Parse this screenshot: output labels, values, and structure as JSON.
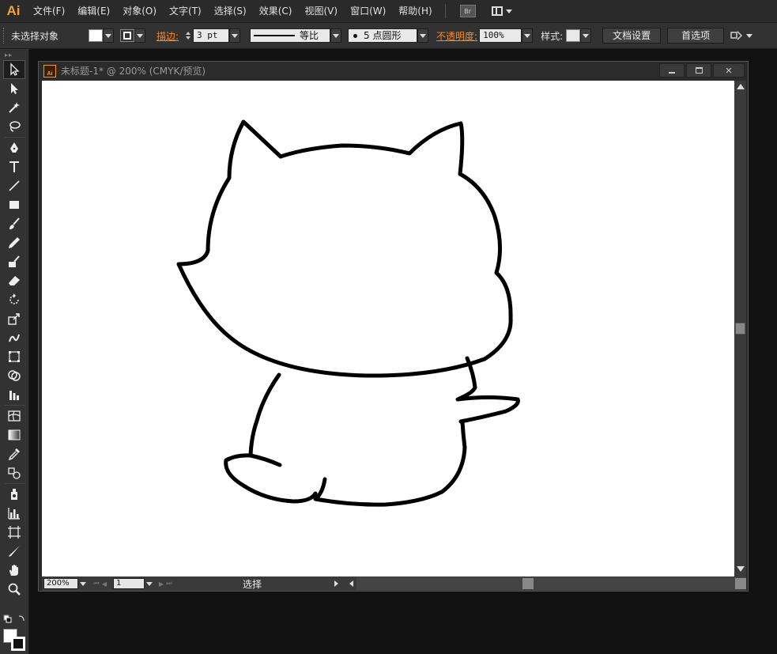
{
  "app": {
    "logo": "Ai",
    "accent": "#f7a32b"
  },
  "menu": [
    {
      "key": "file",
      "label": "文件(F)"
    },
    {
      "key": "edit",
      "label": "编辑(E)"
    },
    {
      "key": "object",
      "label": "对象(O)"
    },
    {
      "key": "type",
      "label": "文字(T)"
    },
    {
      "key": "select",
      "label": "选择(S)"
    },
    {
      "key": "effect",
      "label": "效果(C)"
    },
    {
      "key": "view",
      "label": "视图(V)"
    },
    {
      "key": "window",
      "label": "窗口(W)"
    },
    {
      "key": "help",
      "label": "帮助(H)"
    }
  ],
  "bridge_label": "Br",
  "control": {
    "selection": "未选择对象",
    "stroke_label": "描边:",
    "stroke_weight": "3 pt",
    "stroke_profile": "等比",
    "brush": "5 点圆形",
    "opacity_label": "不透明度:",
    "opacity_value": "100%",
    "style_label": "样式:",
    "doc_setup": "文档设置",
    "prefs": "首选项"
  },
  "document": {
    "title": "未标题-1* @ 200% (CMYK/预览)",
    "icon_label": "Ai",
    "close_symbol": "✕"
  },
  "status": {
    "zoom": "200%",
    "artboard": "1",
    "tool_status": "选择"
  },
  "tools": [
    {
      "name": "selection-tool-icon",
      "active": true
    },
    {
      "name": "direct-selection-tool-icon"
    },
    {
      "name": "magic-wand-tool-icon"
    },
    {
      "name": "lasso-tool-icon"
    },
    {
      "name": "pen-tool-icon"
    },
    {
      "name": "type-tool-icon"
    },
    {
      "name": "line-tool-icon"
    },
    {
      "name": "rectangle-tool-icon"
    },
    {
      "name": "paintbrush-tool-icon"
    },
    {
      "name": "pencil-tool-icon"
    },
    {
      "name": "blob-brush-tool-icon"
    },
    {
      "name": "eraser-tool-icon"
    },
    {
      "name": "rotate-tool-icon"
    },
    {
      "name": "scale-tool-icon"
    },
    {
      "name": "warp-tool-icon"
    },
    {
      "name": "free-transform-tool-icon"
    },
    {
      "name": "shape-builder-tool-icon"
    },
    {
      "name": "graph-tool-icon"
    },
    {
      "name": "mesh-tool-icon"
    },
    {
      "name": "gradient-tool-icon"
    },
    {
      "name": "eyedropper-tool-icon"
    },
    {
      "name": "blend-tool-icon"
    },
    {
      "name": "symbol-sprayer-tool-icon"
    },
    {
      "name": "column-graph-tool-icon"
    },
    {
      "name": "artboard-tool-icon"
    },
    {
      "name": "slice-tool-icon"
    },
    {
      "name": "hand-tool-icon"
    },
    {
      "name": "zoom-tool-icon"
    }
  ]
}
